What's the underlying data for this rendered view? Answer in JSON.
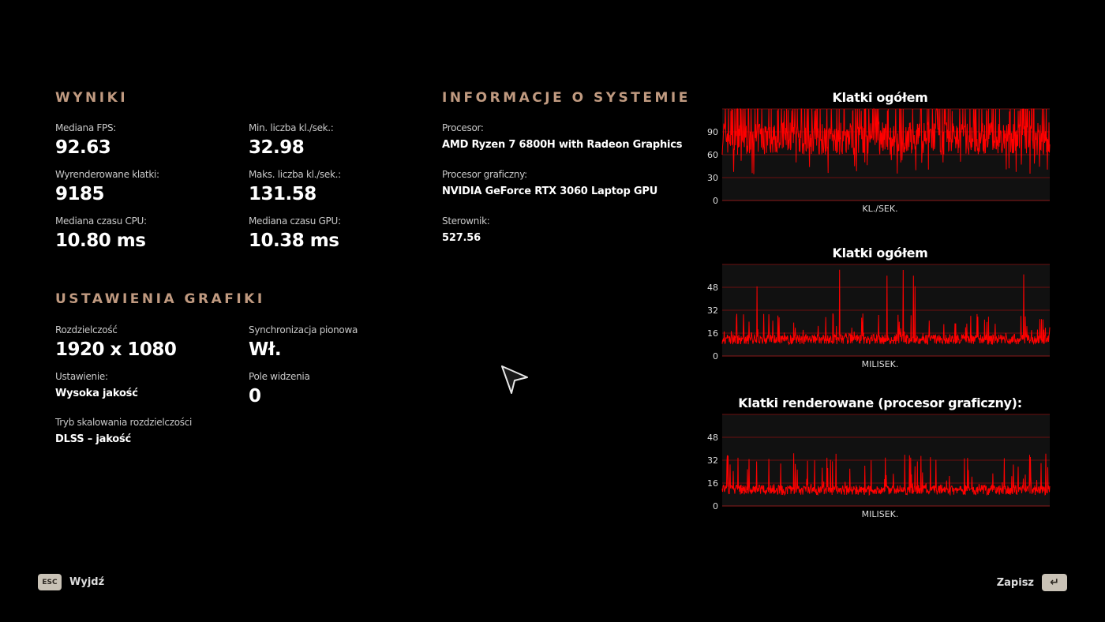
{
  "results": {
    "title": "WYNIKI",
    "stats": [
      {
        "label": "Mediana FPS:",
        "value": "92.63"
      },
      {
        "label": "Min. liczba kl./sek.:",
        "value": "32.98"
      },
      {
        "label": "Wyrenderowane klatki:",
        "value": "9185"
      },
      {
        "label": "Maks. liczba kl./sek.:",
        "value": "131.58"
      },
      {
        "label": "Mediana czasu CPU:",
        "value": "10.80 ms"
      },
      {
        "label": "Mediana czasu GPU:",
        "value": "10.38 ms"
      }
    ]
  },
  "graphics": {
    "title": "USTAWIENIA GRAFIKI",
    "settings": [
      {
        "label": "Rozdzielczość",
        "value": "1920 x 1080"
      },
      {
        "label": "Synchronizacja pionowa",
        "value": "Wł."
      },
      {
        "label": "Ustawienie:",
        "value": "Wysoka jakość"
      },
      {
        "label": "Pole widzenia",
        "value": "0"
      },
      {
        "label": "Tryb skalowania rozdzielczości",
        "value": "DLSS – jakość"
      }
    ]
  },
  "system": {
    "title": "INFORMACJE O SYSTEMIE",
    "items": [
      {
        "label": "Procesor:",
        "value": "AMD Ryzen 7 6800H with Radeon Graphics"
      },
      {
        "label": "Procesor graficzny:",
        "value": "NVIDIA GeForce RTX 3060 Laptop GPU"
      },
      {
        "label": "Sterownik:",
        "value": "527.56"
      }
    ]
  },
  "chart_data": [
    {
      "type": "line",
      "title": "Klatki ogółem",
      "xlabel": "KL./SEK.",
      "ylabel": "",
      "yticks": [
        0,
        30,
        60,
        90
      ],
      "ylim": [
        0,
        120
      ],
      "grid": true,
      "color": "#ff0000",
      "series": [
        {
          "baseline": 85,
          "spread_low": 55,
          "spread_high": 130,
          "min": 33,
          "max": 131.58
        }
      ]
    },
    {
      "type": "line",
      "title": "Klatki ogółem",
      "xlabel": "MILISEK.",
      "ylabel": "",
      "yticks": [
        0,
        16,
        32,
        48
      ],
      "ylim": [
        0,
        64
      ],
      "grid": true,
      "color": "#ff0000",
      "series": [
        {
          "baseline": 11,
          "spread_low": 6,
          "spread_high": 30,
          "spike_max": 62
        }
      ]
    },
    {
      "type": "line",
      "title": "Klatki renderowane (procesor graficzny):",
      "xlabel": "MILISEK.",
      "ylabel": "",
      "yticks": [
        0,
        16,
        32,
        48
      ],
      "ylim": [
        0,
        64
      ],
      "grid": true,
      "color": "#ff0000",
      "series": [
        {
          "baseline": 10.5,
          "spread_low": 5,
          "spread_high": 38,
          "spike_max": 42
        }
      ]
    }
  ],
  "footer": {
    "exit": {
      "key": "ESC",
      "label": "Wyjdź"
    },
    "save": {
      "key": "↵",
      "label": "Zapisz"
    }
  },
  "icons": [
    "cursor-arrow-icon",
    "esc-key-icon",
    "enter-key-icon"
  ]
}
